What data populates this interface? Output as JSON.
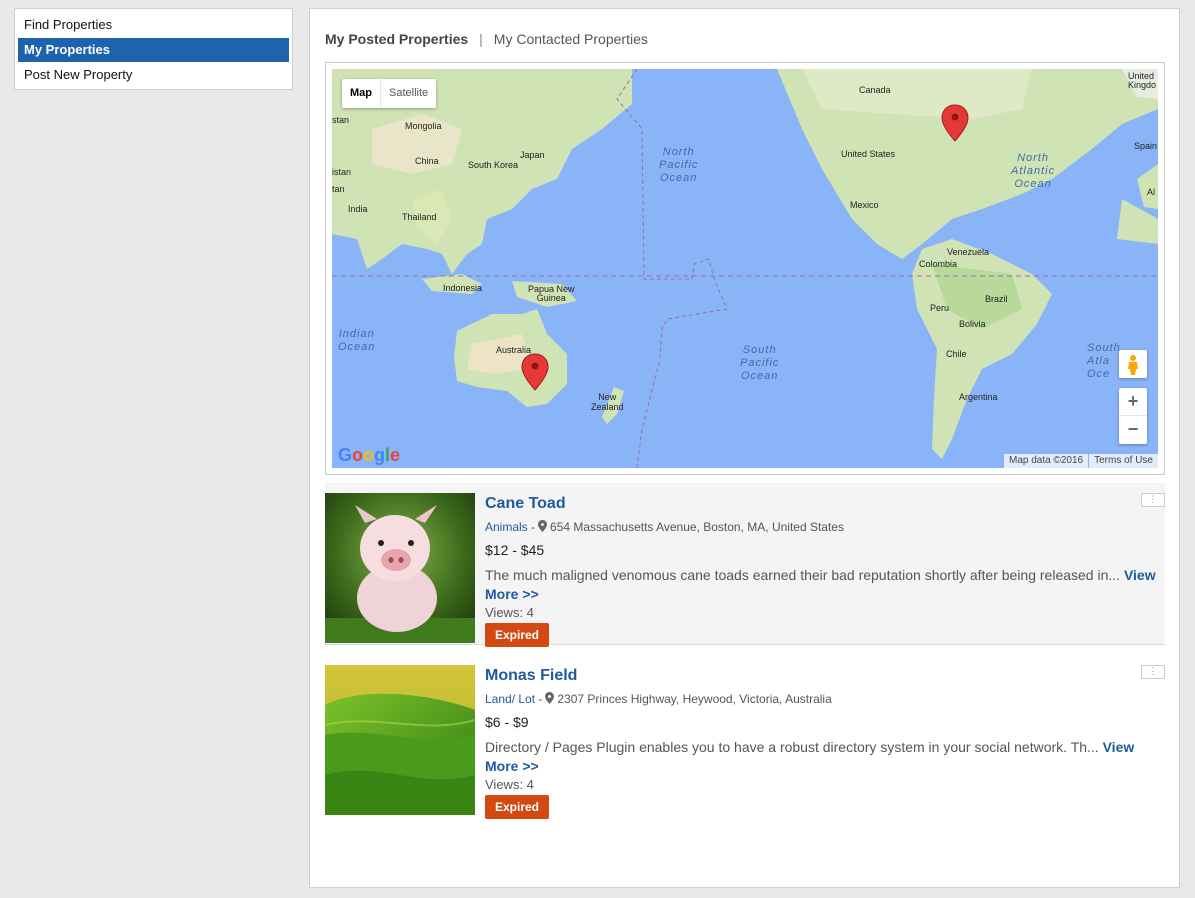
{
  "sidebar": {
    "items": [
      {
        "label": "Find Properties",
        "active": false
      },
      {
        "label": "My Properties",
        "active": true
      },
      {
        "label": "Post New Property",
        "active": false
      }
    ]
  },
  "tabs": {
    "posted": "My Posted Properties",
    "separator": "|",
    "contacted": "My Contacted Properties"
  },
  "map": {
    "type_map": "Map",
    "type_satellite": "Satellite",
    "zoom_in": "+",
    "zoom_out": "−",
    "map_data": "Map data ©2016",
    "terms": "Terms of Use",
    "labels": {
      "canada": "Canada",
      "united_kingdom": "United\nKingdo",
      "mongolia": "Mongolia",
      "china": "China",
      "south_korea": "South Korea",
      "japan": "Japan",
      "united_states": "United States",
      "spain": "Spain",
      "india": "India",
      "thailand": "Thailand",
      "mexico": "Mexico",
      "venezuela": "Venezuela",
      "colombia": "Colombia",
      "indonesia": "Indonesia",
      "png": "Papua New\nGuinea",
      "brazil": "Brazil",
      "peru": "Peru",
      "bolivia": "Bolivia",
      "australia": "Australia",
      "chile": "Chile",
      "argentina": "Argentina",
      "new_zealand": "New\nZealand",
      "stan1": "stan",
      "stan2": "tan",
      "stan3": "istan",
      "al": "Al"
    },
    "oceans": {
      "north_pacific": "North\nPacific\nOcean",
      "north_atlantic": "North\nAtlantic\nOcean",
      "indian": "Indian\nOcean",
      "south_pacific": "South\nPacific\nOcean",
      "south_atlantic": "South\nAtla\nOce"
    }
  },
  "listings": [
    {
      "title": "Cane Toad",
      "category": "Animals",
      "separator": "-",
      "address": "654 Massachusetts Avenue, Boston, MA, United States",
      "price": "$12 - $45",
      "description": "The much maligned venomous cane toads earned their bad reputation shortly after being released in...",
      "more": "View More >>",
      "views": "Views: 4",
      "status": "Expired"
    },
    {
      "title": "Monas Field",
      "category": "Land/ Lot",
      "separator": "-",
      "address": "2307 Princes Highway, Heywood, Victoria, Australia",
      "price": "$6 - $9",
      "description": "Directory / Pages Plugin enables you to have a robust directory system in your social network. Th...",
      "more": "View More >>",
      "views": "Views: 4",
      "status": "Expired"
    }
  ],
  "colors": {
    "accent": "#1f62ad",
    "link": "#1f5a9e",
    "expired": "#d24a12",
    "ocean": "#8ab4f8",
    "land": "#cfe3b4"
  }
}
